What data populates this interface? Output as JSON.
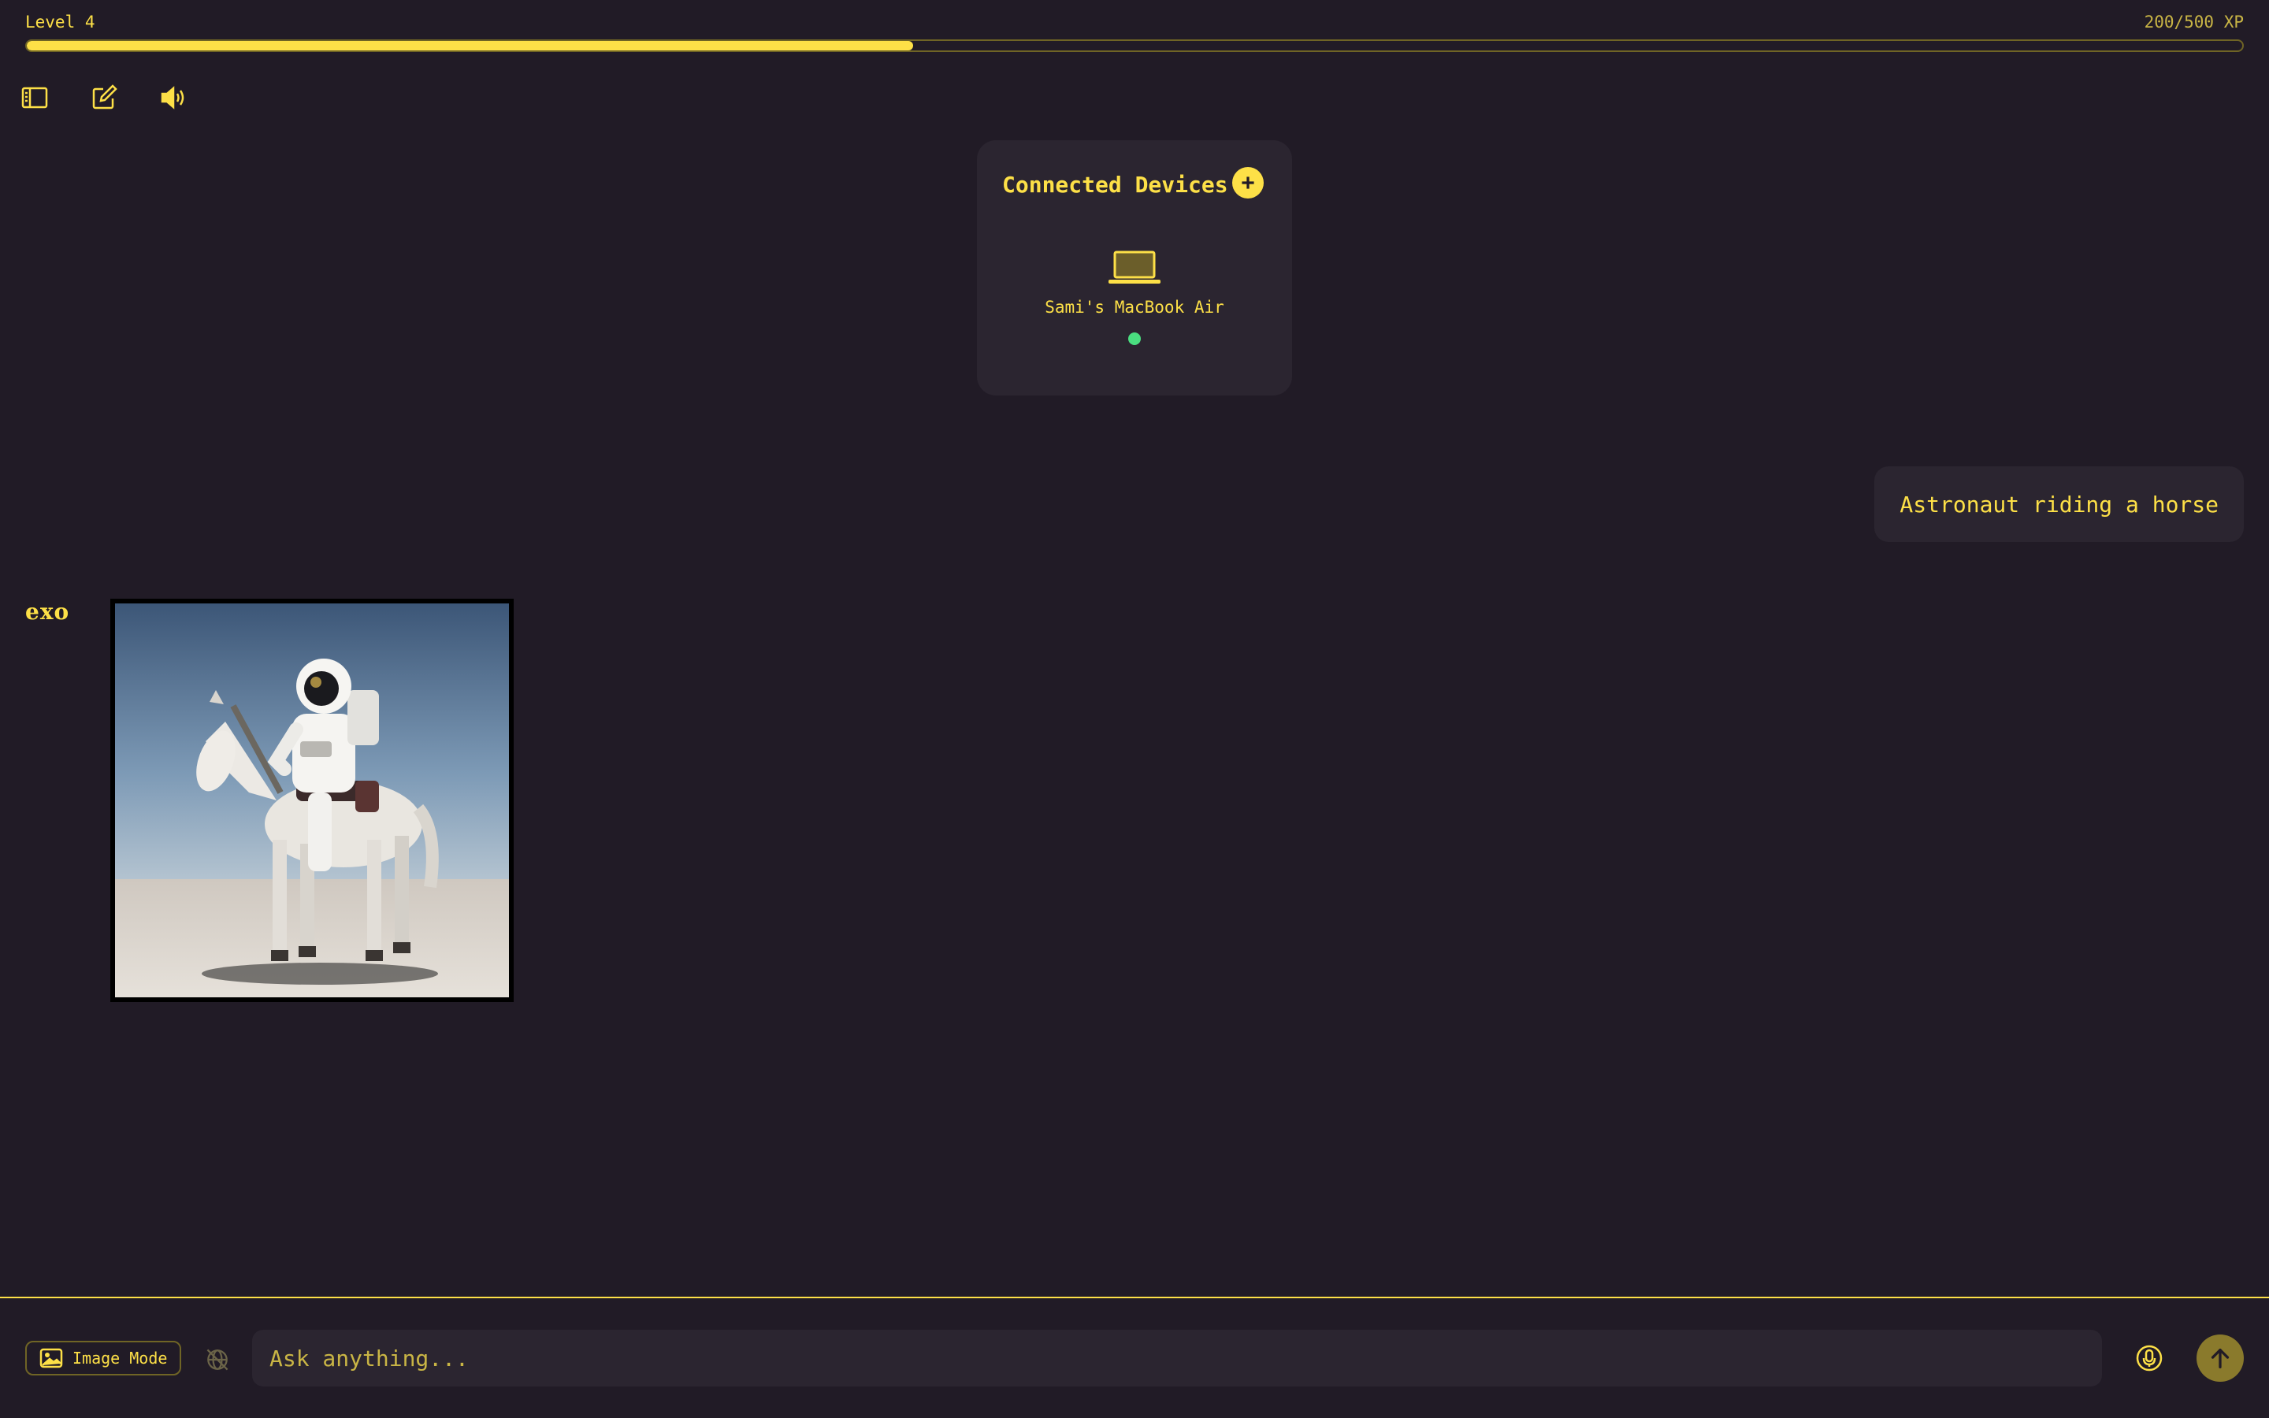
{
  "xp": {
    "level_label": "Level 4",
    "xp_label": "200/500 XP",
    "progress_fraction": 0.4
  },
  "toolbar": {
    "sidebar_icon": "sidebar-toggle-icon",
    "new_chat_icon": "new-chat-icon",
    "sound_icon": "speaker-icon"
  },
  "devices": {
    "title": "Connected Devices",
    "add_icon": "plus-circle-icon",
    "items": [
      {
        "name": "Sami's MacBook Air",
        "icon": "laptop-icon",
        "status": "online"
      }
    ]
  },
  "conversation": {
    "user_message": "Astronaut riding a horse",
    "assistant_label": "exo",
    "generated_image_icon": "generated-image"
  },
  "composer": {
    "image_mode_label": "Image Mode",
    "placeholder": "Ask anything...",
    "web_icon": "web-search-off-icon",
    "mic_icon": "microphone-icon",
    "send_icon": "arrow-up-icon"
  },
  "colors": {
    "background": "#211b26",
    "accent": "#fde047",
    "card": "#2b2530",
    "status_online": "#4ade80"
  }
}
